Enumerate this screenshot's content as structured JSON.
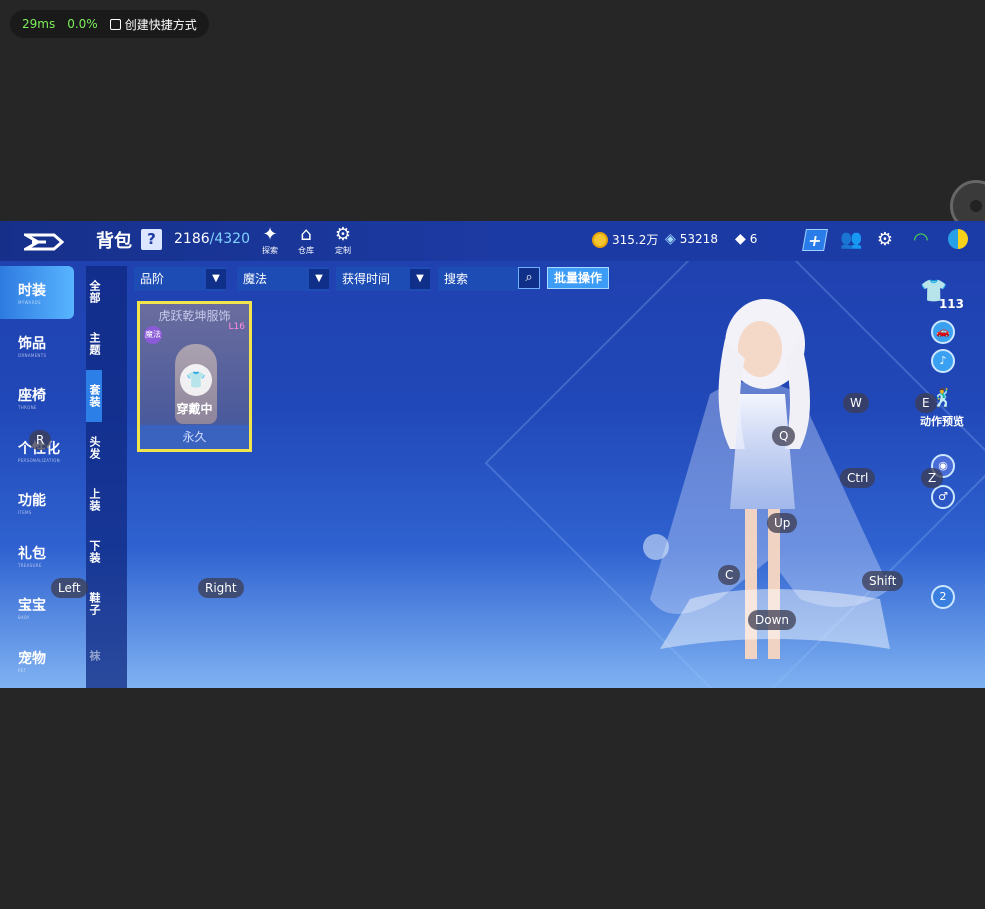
{
  "overlay": {
    "latency": "29ms",
    "loss": "0.0%",
    "shortcut_label": "创建快捷方式"
  },
  "topbar": {
    "title": "背包",
    "help": "?",
    "capacity_used": "2186",
    "capacity_max": "/4320",
    "icons": [
      {
        "name": "explore",
        "label": "探索"
      },
      {
        "name": "warehouse",
        "label": "仓库"
      },
      {
        "name": "custom",
        "label": "定制"
      }
    ],
    "coins": "315.2万",
    "diamonds": "53218",
    "gems": "6"
  },
  "left_nav": [
    {
      "zh": "时装",
      "en": "MYWARDS"
    },
    {
      "zh": "饰品",
      "en": "ORNAMENTS"
    },
    {
      "zh": "座椅",
      "en": "THRONE"
    },
    {
      "zh": "个性化",
      "en": "PERSONALIZATION"
    },
    {
      "zh": "功能",
      "en": "ITEMS"
    },
    {
      "zh": "礼包",
      "en": "TREASURE"
    },
    {
      "zh": "宝宝",
      "en": "BABY"
    },
    {
      "zh": "宠物",
      "en": "PET"
    }
  ],
  "sub_nav": [
    "全部",
    "主题",
    "套装",
    "头发",
    "上装",
    "下装",
    "鞋子",
    "袜"
  ],
  "filters": {
    "grade": "品阶",
    "type": "魔法",
    "time": "获得时间",
    "search_placeholder": "搜索",
    "batch": "批量操作"
  },
  "card": {
    "name": "虎跃乾坤服饰",
    "tag": "魔法",
    "level": "L16",
    "status": "穿戴中",
    "duration": "永久"
  },
  "right_panel": {
    "outfit_count": "113",
    "action_preview": "动作预览",
    "badge": "2"
  },
  "keys": {
    "r": "R",
    "left": "Left",
    "right": "Right",
    "w": "W",
    "e": "E",
    "q": "Q",
    "ctrl": "Ctrl",
    "z": "Z",
    "up": "Up",
    "c": "C",
    "shift": "Shift",
    "down": "Down"
  }
}
